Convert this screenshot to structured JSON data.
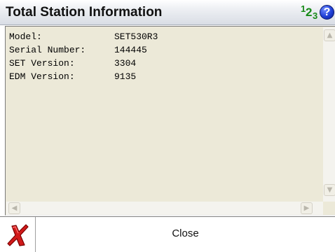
{
  "title": "Total Station Information",
  "icons": {
    "input_mode": "input-mode-123-icon",
    "help": "help-icon",
    "cancel": "red-x-icon"
  },
  "input_mode_digits": [
    "1",
    "2",
    "3"
  ],
  "help_symbol": "?",
  "info": [
    {
      "label": "Model:",
      "value": "SET530R3"
    },
    {
      "label": "Serial Number:",
      "value": "144445"
    },
    {
      "label": "SET Version:",
      "value": "3304"
    },
    {
      "label": "EDM Version:",
      "value": "9135"
    }
  ],
  "scroll_arrows": {
    "up": "▲",
    "down": "▼",
    "left": "◀",
    "right": "▶"
  },
  "buttons": {
    "close": "Close"
  },
  "colors": {
    "panel_background": "#ece9d8",
    "input_mode_green": "#178a17",
    "help_blue": "#1f3fd6",
    "cancel_red": "#d11a1a"
  }
}
